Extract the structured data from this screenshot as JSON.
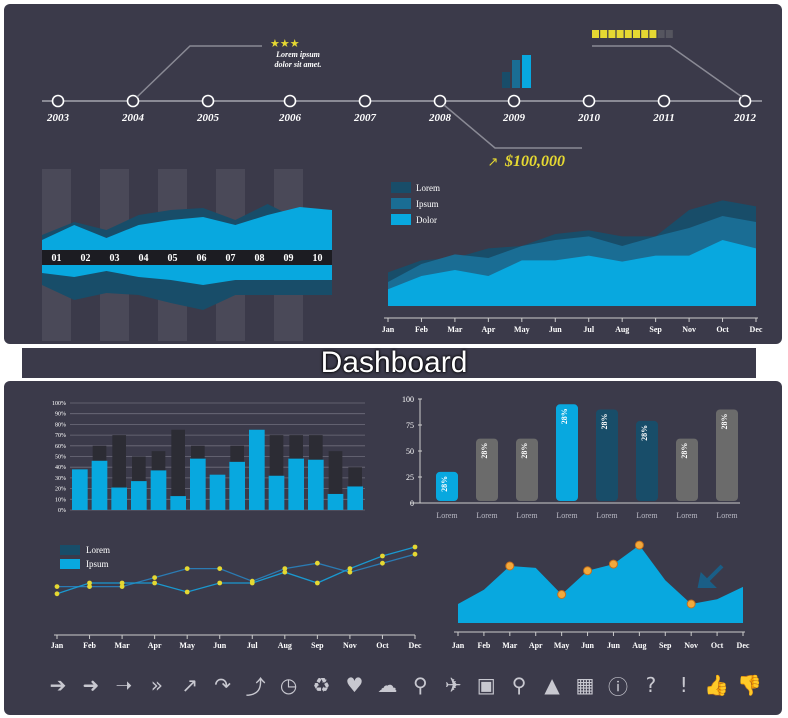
{
  "title": "Dashboard",
  "colors": {
    "panel": "#3b3a4a",
    "bright": "#08a8df",
    "mid": "#1a6d94",
    "dark": "#184d69",
    "gray": "#6b6b6b",
    "yellow": "#e5d832",
    "orange": "#f2a93b",
    "axis": "#cccccc",
    "text": "#ffffff"
  },
  "timeline": {
    "years": [
      "2003",
      "2004",
      "2005",
      "2006",
      "2007",
      "2008",
      "2009",
      "2010",
      "2011",
      "2012"
    ],
    "callout_text": "Lorem ipsum dolor sit amet.",
    "stars": "★★★",
    "money": "$100,000",
    "yellow_level": 0.75
  },
  "chart_data": [
    {
      "type": "area",
      "categories": [
        "01",
        "02",
        "03",
        "04",
        "05",
        "06",
        "07",
        "08",
        "09",
        "10"
      ],
      "series_top": [
        {
          "values": [
            15,
            28,
            20,
            35,
            40,
            42,
            30,
            46,
            30,
            38
          ]
        },
        {
          "values": [
            10,
            25,
            12,
            25,
            30,
            33,
            25,
            35,
            43,
            40
          ]
        }
      ],
      "series_bottom": [
        {
          "values": [
            20,
            35,
            28,
            30,
            38,
            45,
            30,
            30,
            30,
            30
          ]
        },
        {
          "values": [
            8,
            12,
            6,
            12,
            15,
            20,
            15,
            15,
            15,
            15
          ]
        }
      ]
    },
    {
      "type": "area",
      "categories": [
        "Jan",
        "Feb",
        "Mar",
        "Apr",
        "May",
        "Jun",
        "Jul",
        "Aug",
        "Sep",
        "Nov",
        "Oct",
        "Dec"
      ],
      "series": [
        {
          "name": "Lorem",
          "values": [
            28,
            38,
            40,
            48,
            50,
            60,
            63,
            58,
            58,
            80,
            88,
            83
          ]
        },
        {
          "name": "Ipsum",
          "values": [
            20,
            35,
            43,
            40,
            50,
            55,
            58,
            50,
            58,
            65,
            75,
            70
          ]
        },
        {
          "name": "Dolor",
          "values": [
            14,
            25,
            30,
            25,
            38,
            38,
            42,
            37,
            42,
            42,
            55,
            48
          ]
        }
      ]
    },
    {
      "type": "bar",
      "yticks": [
        "0%",
        "10%",
        "20%",
        "30%",
        "40%",
        "50%",
        "60%",
        "70%",
        "80%",
        "90%",
        "100%"
      ],
      "ylim": [
        0,
        100
      ],
      "series": [
        {
          "values": [
            60,
            70,
            50,
            55,
            75,
            60,
            60,
            70,
            70,
            70,
            55,
            40,
            30
          ]
        },
        {
          "values": [
            38,
            46,
            21,
            27,
            37,
            13,
            48,
            33,
            45,
            75,
            32,
            48,
            47,
            15,
            22
          ]
        }
      ]
    },
    {
      "type": "bar",
      "categories": [
        "Lorem",
        "Lorem",
        "Lorem",
        "Lorem",
        "Lorem",
        "Lorem",
        "Lorem",
        "Lorem"
      ],
      "yticks": [
        "0",
        "25",
        "50",
        "75",
        "100"
      ],
      "ylim": [
        0,
        100
      ],
      "values": [
        28,
        60,
        60,
        93,
        88,
        77,
        60,
        88
      ],
      "labels": [
        "28%",
        "28%",
        "28%",
        "28%",
        "28%",
        "28%",
        "28%",
        "28%"
      ]
    },
    {
      "type": "line",
      "categories": [
        "Jan",
        "Feb",
        "Mar",
        "Apr",
        "May",
        "Jun",
        "Jul",
        "Aug",
        "Sep",
        "Nov",
        "Oct",
        "Dec"
      ],
      "series": [
        {
          "name": "Lorem",
          "values": [
            46,
            46,
            46,
            56,
            66,
            66,
            52,
            66,
            72,
            62,
            72,
            82
          ]
        },
        {
          "name": "Ipsum",
          "values": [
            38,
            50,
            50,
            50,
            40,
            50,
            50,
            62,
            50,
            66,
            80,
            90
          ]
        }
      ]
    },
    {
      "type": "area",
      "categories": [
        "Jan",
        "Feb",
        "Mar",
        "Apr",
        "May",
        "Jun",
        "Jun",
        "Aug",
        "Sep",
        "Nov",
        "Oct",
        "Dec"
      ],
      "values": [
        20,
        35,
        60,
        58,
        30,
        55,
        62,
        82,
        45,
        20,
        25,
        38
      ]
    }
  ],
  "icons": [
    "arrow-right-icon",
    "arrow-right-bold-icon",
    "arrow-right-thin-icon",
    "double-chevron-icon",
    "arrow-diagonal-icon",
    "arrow-curved-icon",
    "arrow-up-turn-icon",
    "clock-icon",
    "recycle-icon",
    "heart-icon",
    "cloud-icon",
    "search-icon",
    "airplane-icon",
    "bus-icon",
    "bicycle-icon",
    "graduation-cap-icon",
    "calculator-icon",
    "info-icon",
    "question-icon",
    "exclamation-icon",
    "thumbs-up-icon",
    "thumbs-down-icon"
  ],
  "icon_glyphs": [
    "➔",
    "➜",
    "➝",
    "»",
    "↗",
    "↷",
    "⤴",
    "◷",
    "♻",
    "♥",
    "☁",
    "⚲",
    "✈",
    "▣",
    "⚲",
    "▲",
    "▦",
    "ⓘ",
    "?",
    "!",
    "👍",
    "👎"
  ]
}
